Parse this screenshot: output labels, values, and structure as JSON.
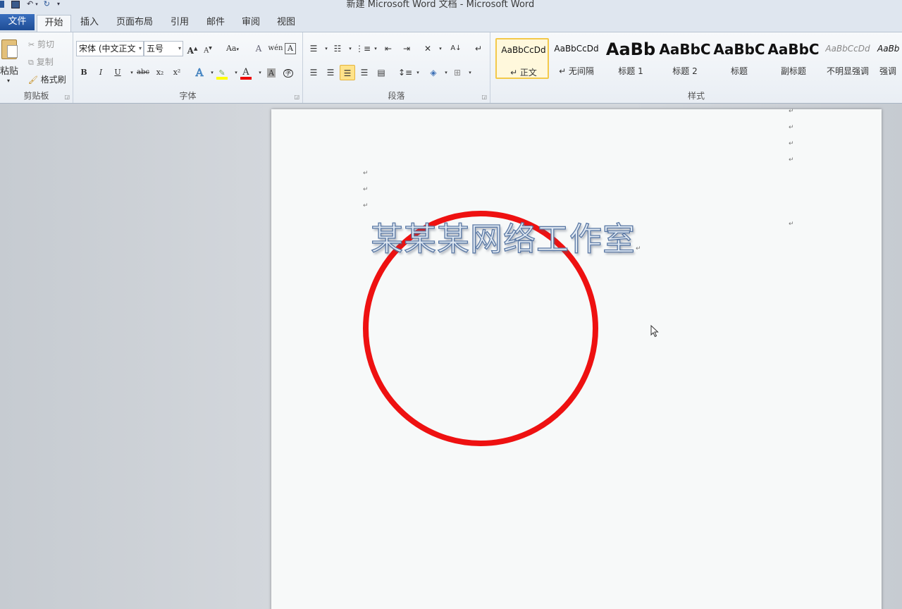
{
  "window": {
    "title": "新建 Microsoft Word 文档 - Microsoft Word"
  },
  "tabs": [
    {
      "label": "文件"
    },
    {
      "label": "开始"
    },
    {
      "label": "插入"
    },
    {
      "label": "页面布局"
    },
    {
      "label": "引用"
    },
    {
      "label": "邮件"
    },
    {
      "label": "审阅"
    },
    {
      "label": "视图"
    }
  ],
  "clipboard": {
    "paste": "粘贴",
    "cut": "剪切",
    "copy": "复制",
    "format_painter": "格式刷",
    "group_label": "剪贴板"
  },
  "font": {
    "name": "宋体 (中文正文",
    "size": "五号",
    "group_label": "字体",
    "bold": "B",
    "italic": "I",
    "underline": "U",
    "strike": "abc",
    "subscript": "x₂",
    "superscript": "x²",
    "grow": "A",
    "shrink": "A",
    "change_case": "Aa",
    "clear_format": "A",
    "phonetic": "wén",
    "char_border": "A",
    "text_effects": "A",
    "font_color": "A",
    "char_shading": "A",
    "enclose": "字"
  },
  "paragraph": {
    "group_label": "段落"
  },
  "styles": {
    "group_label": "样式",
    "items": [
      {
        "sample": "AaBbCcDd",
        "name": "↵ 正文"
      },
      {
        "sample": "AaBbCcDd",
        "name": "↵ 无间隔"
      },
      {
        "sample": "AaBb",
        "name": "标题 1"
      },
      {
        "sample": "AaBbC",
        "name": "标题 2"
      },
      {
        "sample": "AaBbC",
        "name": "标题"
      },
      {
        "sample": "AaBbC",
        "name": "副标题"
      },
      {
        "sample": "AaBbCcDd",
        "name": "不明显强调"
      },
      {
        "sample": "AaBb",
        "name": "强调"
      }
    ]
  },
  "document": {
    "wordart_text": "某某某网络工作室",
    "paragraph_mark": "↵",
    "shape": "red-circle-outline",
    "accent_color": "#ee1111"
  }
}
